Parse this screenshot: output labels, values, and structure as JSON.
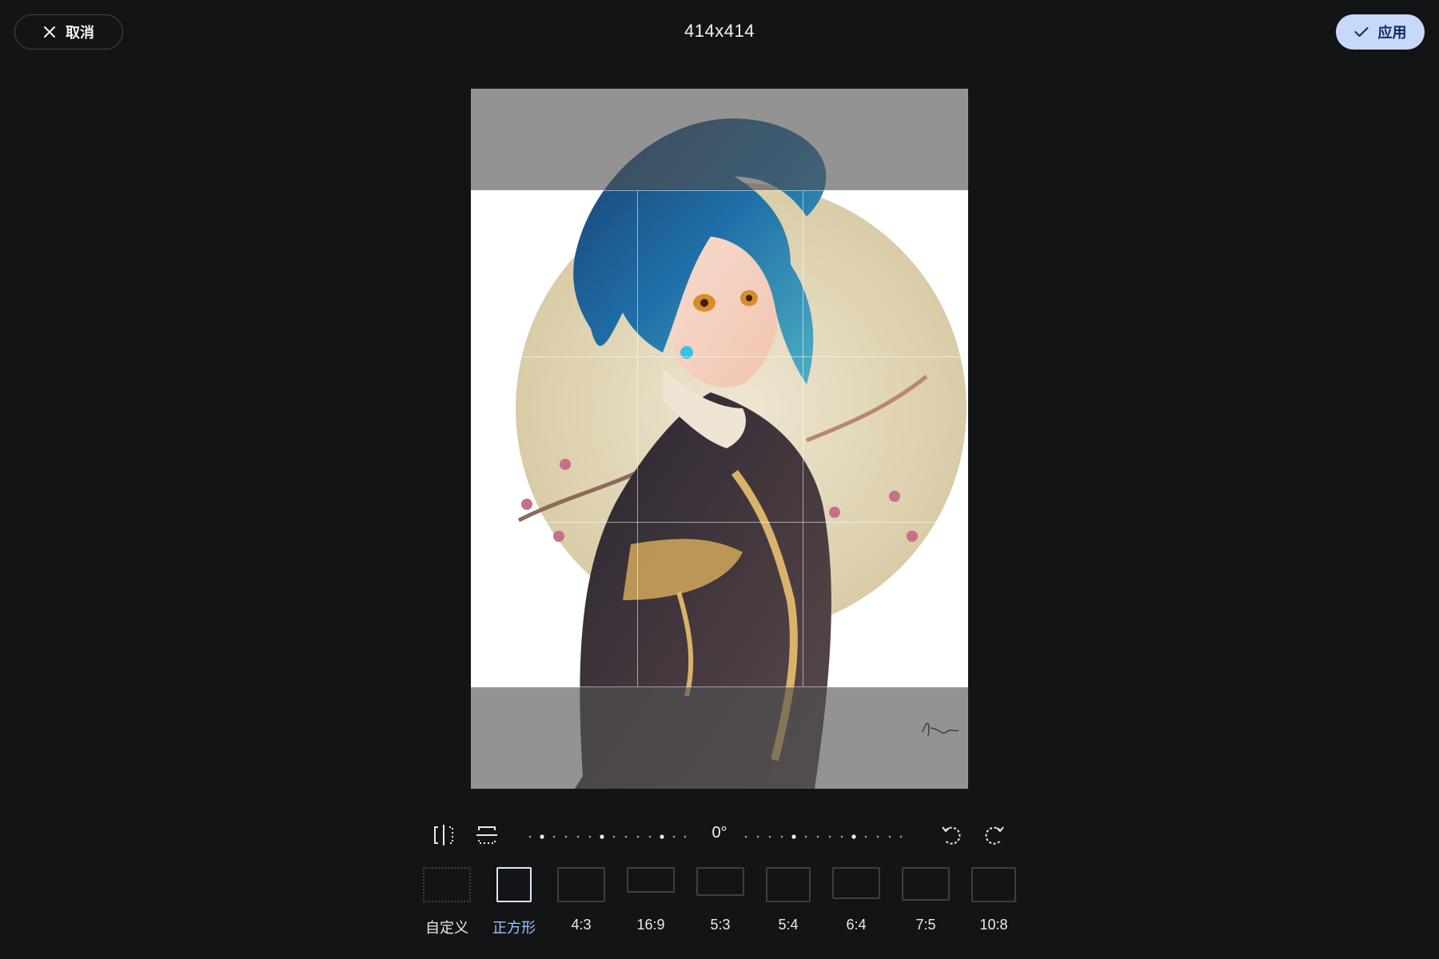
{
  "header": {
    "cancel_label": "取消",
    "dimensions": "414x414",
    "apply_label": "应用"
  },
  "toolbar": {
    "flip_horizontal_icon": "flip-horizontal-icon",
    "flip_vertical_icon": "flip-vertical-icon",
    "rotation_angle": "0°",
    "rotate_left_icon": "rotate-left-icon",
    "rotate_right_icon": "rotate-right-icon"
  },
  "aspect_ratios": [
    {
      "label": "自定义",
      "selected": false
    },
    {
      "label": "正方形",
      "selected": true
    },
    {
      "label": "4:3",
      "selected": false
    },
    {
      "label": "16:9",
      "selected": false
    },
    {
      "label": "5:3",
      "selected": false
    },
    {
      "label": "5:4",
      "selected": false
    },
    {
      "label": "6:4",
      "selected": false
    },
    {
      "label": "7:5",
      "selected": false
    },
    {
      "label": "10:8",
      "selected": false
    }
  ],
  "colors": {
    "background": "#131416",
    "apply_button": "#c8d8fb",
    "selected_ratio": "#9ec2ff"
  }
}
